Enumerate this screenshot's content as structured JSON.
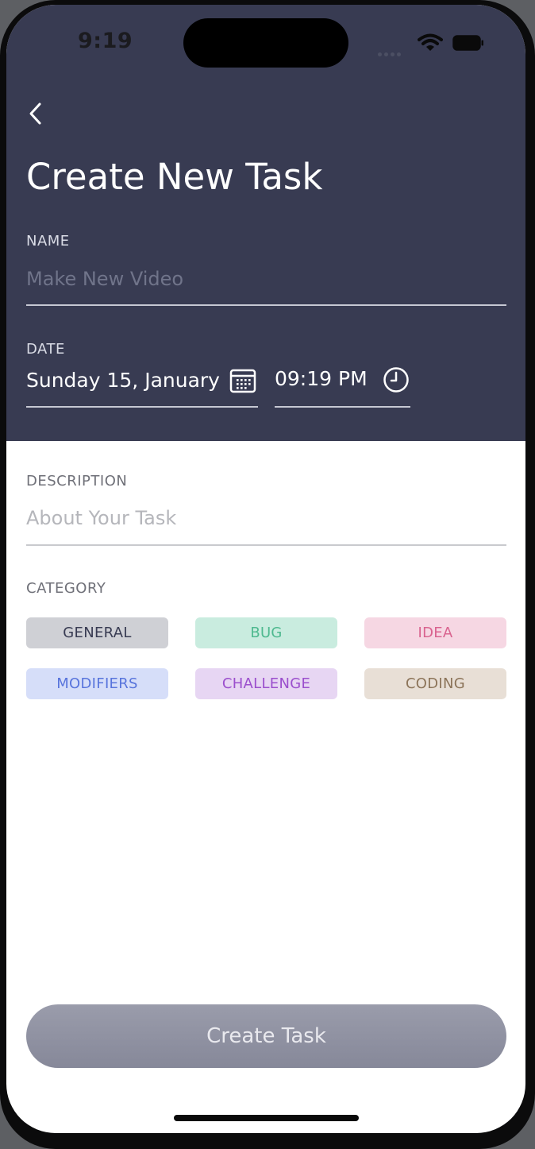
{
  "status_bar": {
    "time": "9:19"
  },
  "header": {
    "title": "Create New Task"
  },
  "name_field": {
    "label": "NAME",
    "placeholder": "Make New Video"
  },
  "date_field": {
    "label": "DATE",
    "date_value": "Sunday 15, January",
    "time_value": "09:19 PM"
  },
  "description_field": {
    "label": "DESCRIPTION",
    "placeholder": "About Your Task"
  },
  "category": {
    "label": "CATEGORY",
    "chips": [
      {
        "label": "GENERAL",
        "bg": "#cfd0d5",
        "fg": "#383b52"
      },
      {
        "label": "BUG",
        "bg": "#c9ecdf",
        "fg": "#4eb98f"
      },
      {
        "label": "IDEA",
        "bg": "#f6d7e3",
        "fg": "#d9638f"
      },
      {
        "label": "MODIFIERS",
        "bg": "#d6def9",
        "fg": "#5874dc"
      },
      {
        "label": "CHALLENGE",
        "bg": "#e7d6f3",
        "fg": "#9b4fcd"
      },
      {
        "label": "CODING",
        "bg": "#e8dfd6",
        "fg": "#8c7459"
      }
    ]
  },
  "create_button": {
    "label": "Create Task"
  },
  "colors": {
    "header_bg": "#383b52",
    "button_bg": "#8e909f"
  }
}
